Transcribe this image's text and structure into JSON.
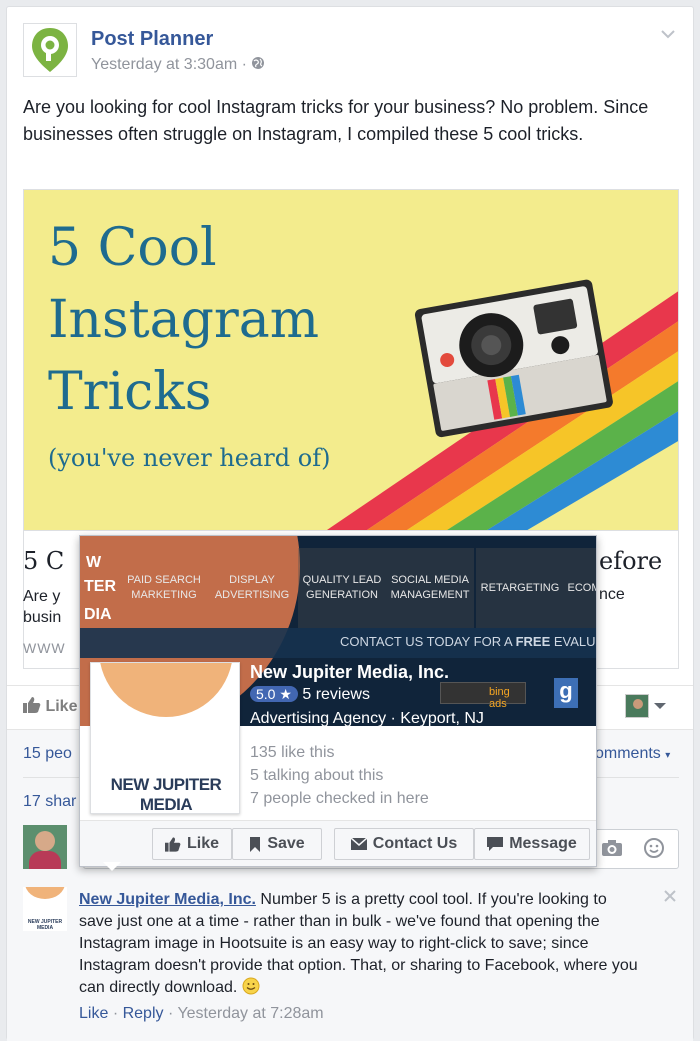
{
  "post": {
    "page_name": "Post Planner",
    "timestamp": "Yesterday at 3:30am ·",
    "text": "Are you looking for cool Instagram tricks for your business? No problem. Since businesses often struggle on Instagram, I compiled these 5 cool tricks.",
    "image": {
      "line1": "5 Cool",
      "line2": "Instagram",
      "line3": "Tricks",
      "line4": "(you've never heard of)"
    },
    "link_title_left": "5 C",
    "link_title_right": "efore",
    "link_desc_left": "Are y",
    "link_desc_left2": "busin",
    "link_desc_right": "nce",
    "link_domain": "WWW",
    "like_label": "Like"
  },
  "stats": {
    "likes": "15 peo",
    "comments": "omments",
    "shares": "17 shar"
  },
  "popup": {
    "nav": [
      "PAID SEARCH\nMARKETING",
      "DISPLAY\nADVERTISING",
      "QUALITY LEAD\nGENERATION",
      "SOCIAL MEDIA\nMANAGEMENT",
      "RETARGETING",
      "ECOM"
    ],
    "brand_fragment_1": "W",
    "brand_fragment_2": "TER",
    "brand_fragment_3": "DIA",
    "cta": "CONTACT US TODAY FOR A",
    "cta_bold": "FREE",
    "cta_tail": "EVALU",
    "name": "New Jupiter Media, Inc.",
    "rating": "5.0 ★",
    "reviews": "5 reviews",
    "category": "Advertising Agency · Keyport, NJ",
    "bing": "bing ads",
    "profile_logo": "NEW JUPITER MEDIA",
    "likes": "135 like this",
    "talking": "5 talking about this",
    "checkins": "7 people checked in here",
    "btn_like": "Like",
    "btn_save": "Save",
    "btn_contact": "Contact Us",
    "btn_message": "Message"
  },
  "comment": {
    "author": "New Jupiter Media, Inc.",
    "text": " Number 5 is a pretty cool tool. If you're looking to save just one at a time - rather than in bulk - we've found that opening the Instagram image in Hootsuite is an easy way to right-click to save; since Instagram doesn't provide that option. That, or sharing to Facebook, where you can directly download.",
    "like": "Like",
    "reply": "Reply",
    "time": "Yesterday at 7:28am",
    "avatar_text": "NEW JUPITER MEDIA"
  },
  "colors": {
    "fb_blue": "#365899",
    "logo_green": "#7cb342",
    "hero_bg": "#f3ec8d",
    "hero_text": "#1e6b8f"
  }
}
